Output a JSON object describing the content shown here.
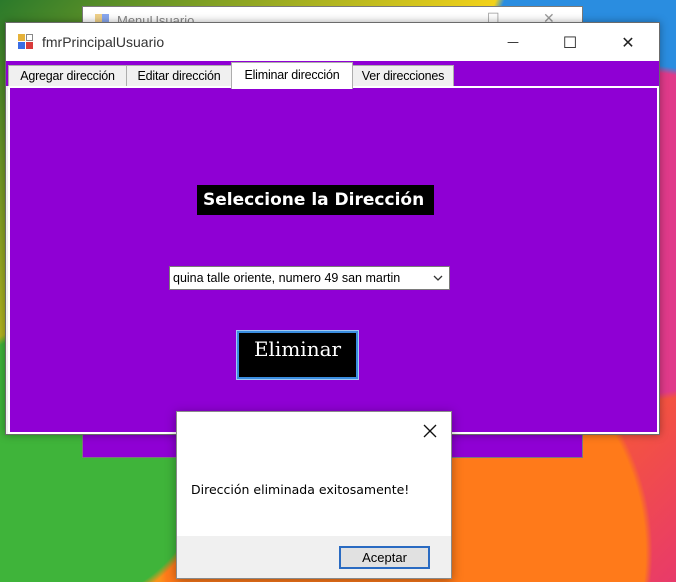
{
  "background_window": {
    "title": "MenuUsuario",
    "maximize_glyph": "☐",
    "close_glyph": "✕"
  },
  "window": {
    "title": "fmrPrincipalUsuario",
    "minimize_glyph": "—",
    "maximize_glyph": "☐",
    "close_glyph": "✕",
    "accent_color": "#8f00d4"
  },
  "tabs": [
    {
      "label": "Agregar dirección",
      "active": false
    },
    {
      "label": "Editar dirección",
      "active": false
    },
    {
      "label": "Eliminar dirección",
      "active": true
    },
    {
      "label": "Ver direcciones",
      "active": false
    }
  ],
  "page": {
    "heading": "Seleccione la Dirección",
    "address_select": {
      "selected": "quina talle oriente, numero 49 san martin"
    },
    "delete_button": "Eliminar"
  },
  "dialog": {
    "message": "Dirección eliminada exitosamente!",
    "ok_button": "Aceptar"
  },
  "icons": {
    "app_icon": "app-icon",
    "dropdown": "chevron-down-icon",
    "dialog_close": "close-icon"
  }
}
